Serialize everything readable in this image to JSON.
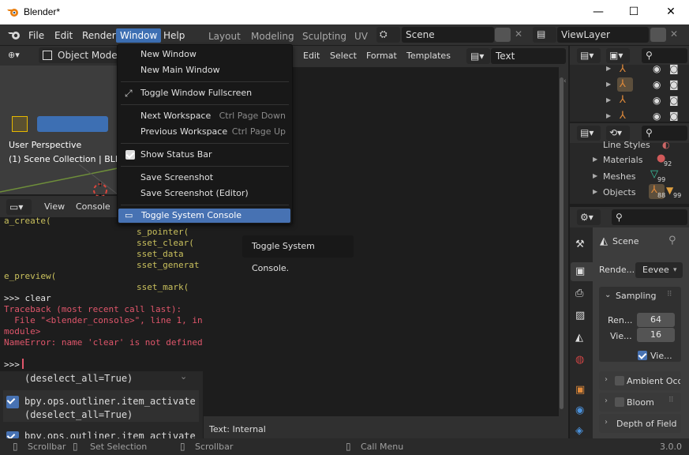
{
  "window": {
    "title": "Blender*",
    "minimize": "—",
    "maximize": "☐",
    "close": "✕"
  },
  "menubar": {
    "file": "File",
    "edit": "Edit",
    "render": "Render",
    "window": "Window",
    "help": "Help"
  },
  "workspaces": [
    "Layout",
    "Modeling",
    "Sculpting",
    "UV"
  ],
  "scene_field": "Scene",
  "viewlayer_field": "ViewLayer",
  "viewport": {
    "mode": "Object Mode",
    "perspective": "User Perspective",
    "collection": "(1) Scene Collection | BLD_"
  },
  "console_header": {
    "view": "View",
    "console": "Console"
  },
  "console_lines": [
    {
      "text": "a_create(",
      "cls": "olive"
    },
    {
      "text": "s_pointer(",
      "cls": "olive"
    },
    {
      "text": "sset_clear(",
      "cls": "olive"
    },
    {
      "text": "sset_data",
      "cls": "olive"
    },
    {
      "text": "sset_generat",
      "cls": "olive"
    },
    {
      "text": "e_preview(",
      "cls": "olive"
    },
    {
      "text": "sset_mark(",
      "cls": "olive"
    },
    {
      "text": ">>> clear",
      "cls": "white"
    },
    {
      "text": "Traceback (most recent call last):",
      "cls": "red"
    },
    {
      "text": "  File \"<blender_console>\", line 1, in <",
      "cls": "red"
    },
    {
      "text": "module>",
      "cls": "red"
    },
    {
      "text": "NameError: name 'clear' is not defined",
      "cls": "red"
    },
    {
      "text": ">>> ",
      "cls": "white"
    }
  ],
  "info_lines": [
    "(deselect_all=True)",
    "bpy.ops.outliner.item_activate",
    "(deselect_all=True)",
    "bpy.ops.outliner.item_activate"
  ],
  "text_editor": {
    "menus": [
      "Edit",
      "Select",
      "Format",
      "Templates"
    ],
    "text_name": "Text",
    "footer": "Text: Internal"
  },
  "window_menu": {
    "new_window": "New Window",
    "new_main_window": "New Main Window",
    "toggle_fullscreen": "Toggle Window Fullscreen",
    "next_workspace": "Next Workspace",
    "next_workspace_sc": "Ctrl Page Down",
    "prev_workspace": "Previous Workspace",
    "prev_workspace_sc": "Ctrl Page Up",
    "show_status_bar": "Show Status Bar",
    "save_screenshot": "Save Screenshot",
    "save_screenshot_editor": "Save Screenshot (Editor)",
    "toggle_system_console": "Toggle System Console"
  },
  "tooltip": "Toggle System Console.",
  "datablocks": [
    {
      "label": "Line Styles",
      "count": ""
    },
    {
      "label": "Materials",
      "count": "92"
    },
    {
      "label": "Meshes",
      "count": "99"
    },
    {
      "label": "Objects",
      "count": "88"
    }
  ],
  "objects_extra": "99",
  "properties": {
    "scene": "Scene",
    "render_label": "Rende...",
    "render_engine": "Eevee",
    "sampling": "Sampling",
    "render_samples_label": "Ren...",
    "render_samples": "64",
    "viewport_samples_label": "Vie...",
    "viewport_samples": "16",
    "viewport_denoise": "Vie...",
    "ambient_occlusion": "Ambient Occl",
    "bloom": "Bloom",
    "depth_of_field": "Depth of Field"
  },
  "statusbar": {
    "scrollbar1": "Scrollbar",
    "set_selection": "Set Selection",
    "scrollbar2": "Scrollbar",
    "call_menu": "Call Menu",
    "version": "3.0.0"
  },
  "colors": {
    "accent": "#4772b3",
    "error": "#e0566b",
    "bg": "#303030"
  }
}
